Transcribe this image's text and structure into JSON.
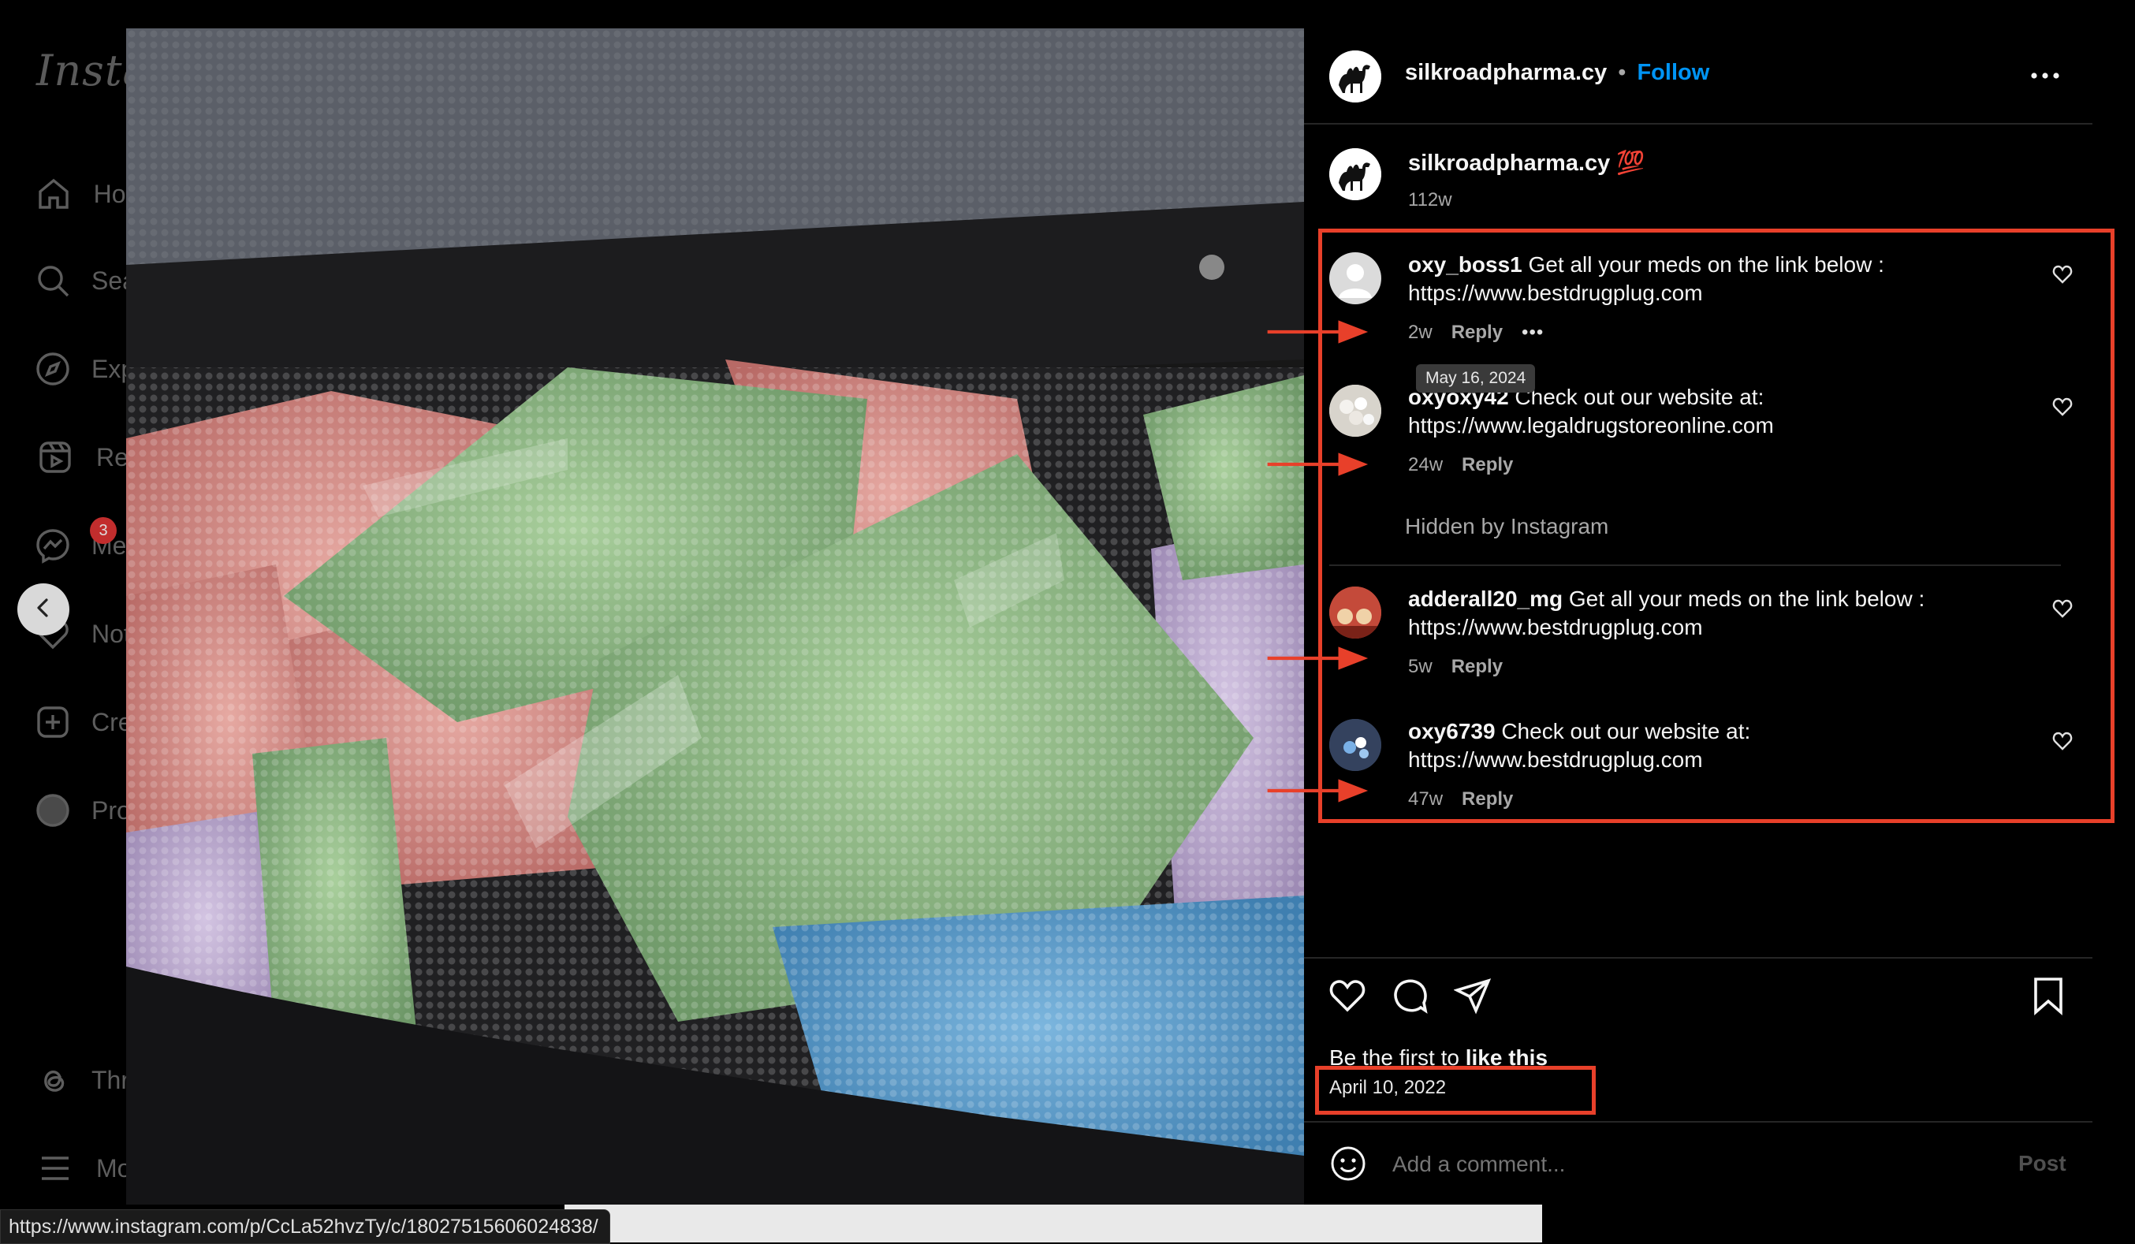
{
  "sidebar": {
    "logo": "Instagram",
    "items": [
      {
        "label": "Home",
        "icon": "home-icon"
      },
      {
        "label": "Search",
        "icon": "search-icon"
      },
      {
        "label": "Explore",
        "icon": "compass-icon"
      },
      {
        "label": "Reels",
        "icon": "reels-icon"
      },
      {
        "label": "Messages",
        "icon": "messenger-icon",
        "badge": "3"
      },
      {
        "label": "Notifications",
        "icon": "heart-icon"
      },
      {
        "label": "Create",
        "icon": "plus-square-icon"
      },
      {
        "label": "Profile",
        "icon": "avatar-icon"
      },
      {
        "label": "Threads",
        "icon": "threads-icon"
      },
      {
        "label": "More",
        "icon": "menu-icon"
      }
    ]
  },
  "header": {
    "username": "silkroadpharma.cy",
    "separator": "•",
    "follow_label": "Follow",
    "more_icon": "more-horizontal-icon"
  },
  "caption": {
    "username": "silkroadpharma.cy",
    "emoji": "💯",
    "time": "112w"
  },
  "comments": [
    {
      "username": "oxy_boss1",
      "text": " Get all your meds on the link below :",
      "link": "https://www.bestdrugplug.com",
      "time": "2w",
      "reply": "Reply",
      "more": "•••"
    },
    {
      "username": "oxyoxy42",
      "text": " Check out our website at:",
      "link": "https://www.legaldrugstoreonline.com",
      "time": "24w",
      "reply": "Reply"
    },
    {
      "username": "adderall20_mg",
      "text": " Get all your meds on the link below :",
      "link": "https://www.bestdrugplug.com",
      "time": "5w",
      "reply": "Reply"
    },
    {
      "username": "oxy6739",
      "text": " Check out our website at:",
      "link": "https://www.bestdrugplug.com",
      "time": "47w",
      "reply": "Reply"
    }
  ],
  "hidden_label": "Hidden by Instagram",
  "tooltip": "May 16, 2024",
  "likes": {
    "prefix": "Be the first to ",
    "action": "like this"
  },
  "post_date": "April 10, 2022",
  "comment_box": {
    "placeholder": "Add a comment...",
    "post_label": "Post"
  },
  "status_url": "https://www.instagram.com/p/CcLa52hvzTy/c/18027515606024838/",
  "colors": {
    "accent_blue": "#0095f6",
    "annotation_red": "#e8402a",
    "background": "#000000"
  }
}
